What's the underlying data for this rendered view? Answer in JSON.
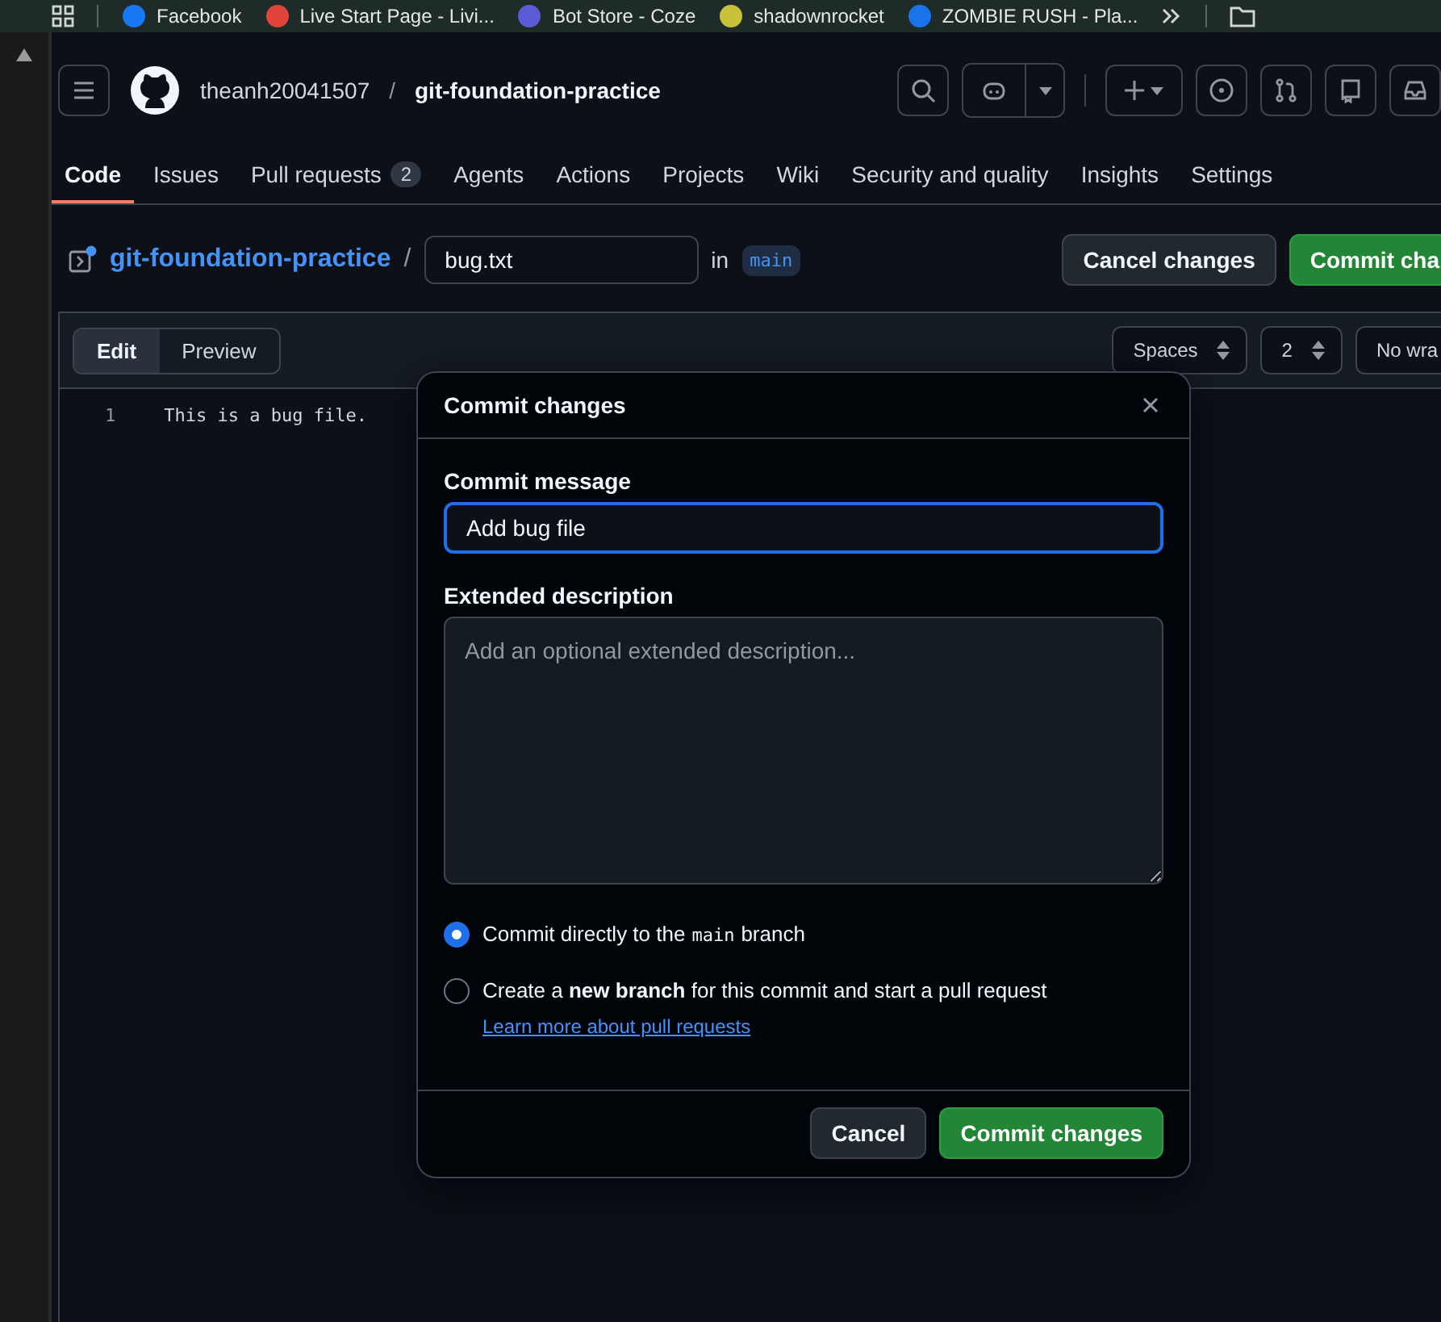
{
  "bookmarks": [
    {
      "label": "Facebook",
      "color": "#1877f2"
    },
    {
      "label": "Live Start Page - Livi...",
      "color": "#e0443a"
    },
    {
      "label": "Bot Store - Coze",
      "color": "#5b5bd6"
    },
    {
      "label": "shadownrocket",
      "color": "#c8c23a"
    },
    {
      "label": "ZOMBIE RUSH - Pla...",
      "color": "#1a73e8"
    }
  ],
  "header": {
    "owner": "theanh20041507",
    "separator": "/",
    "repo": "git-foundation-practice"
  },
  "tabs": [
    {
      "label": "Code",
      "selected": true
    },
    {
      "label": "Issues",
      "selected": false
    },
    {
      "label": "Pull requests",
      "count": "2",
      "selected": false
    },
    {
      "label": "Agents",
      "selected": false
    },
    {
      "label": "Actions",
      "selected": false
    },
    {
      "label": "Projects",
      "selected": false
    },
    {
      "label": "Wiki",
      "selected": false
    },
    {
      "label": "Security and quality",
      "selected": false
    },
    {
      "label": "Insights",
      "selected": false
    },
    {
      "label": "Settings",
      "selected": false
    }
  ],
  "editor": {
    "repo_link": "git-foundation-practice",
    "separator": "/",
    "filename": "bug.txt",
    "in_label": "in",
    "branch": "main",
    "cancel": "Cancel changes",
    "commit": "Commit cha",
    "modes": [
      {
        "label": "Edit",
        "selected": true
      },
      {
        "label": "Preview",
        "selected": false
      }
    ],
    "indent_mode": "Spaces",
    "indent_size": "2",
    "wrap": "No wra",
    "lines": [
      {
        "number": "1",
        "text": "This is a bug file."
      }
    ]
  },
  "dialog": {
    "title": "Commit changes",
    "message_label": "Commit message",
    "message_value": "Add bug file",
    "description_label": "Extended description",
    "description_placeholder": "Add an optional extended description...",
    "options": [
      {
        "label": "Commit directly to the",
        "code": "main",
        "label_end": "branch",
        "selected": true
      },
      {
        "label": "Create a **new branch** for this commit and start a pull request",
        "link": "Learn more about pull requests",
        "selected": false
      }
    ],
    "cancel": "Cancel",
    "commit": "Commit changes"
  }
}
